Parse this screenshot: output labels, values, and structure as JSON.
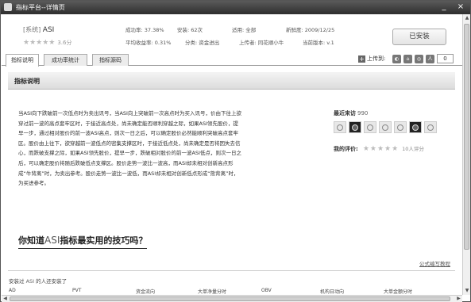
{
  "window": {
    "title": "指标平台--详情页",
    "minimize_label": "_",
    "close_label": "×"
  },
  "header": {
    "system_tag": "[系统]",
    "name": "ASI",
    "stars": "★★★★★",
    "score": "3.6分",
    "win_rate": "成功率: 37.38%",
    "installs": "安装: 62次",
    "applies": "适用: 全部",
    "freshness": "新鲜度: 2009/12/25",
    "avg_return": "平均收益率: 0.31%",
    "category": "分类: 资金进出",
    "uploader": "上传者: 同花顺小牛",
    "version": "当前版本: v.1",
    "install_button": "已安装"
  },
  "tabs": [
    {
      "label": "指标说明",
      "active": true
    },
    {
      "label": "成功率统计",
      "active": false
    },
    {
      "label": "指标源码",
      "active": false
    }
  ],
  "toolbar": {
    "upload_label": "上传到:",
    "count": "0"
  },
  "section": {
    "title": "指标说明"
  },
  "description": "当ASI向下跌破前一次低点时为卖出讯号，当ASI向上突破前一次高点时为买入讯号，价由下往上欲穿过前一波的高点套牢区时，于接近高点处，尚未确定能否顺利穿越之际，如果ASI领先股价，提早一步，通过相对股价的前一波ASI高点，则次一日之后，可以确定股价必然能顺利突破高点套牢区。股价由上往下，欲穿越前一波低点的密集支撑区时，于接近低点处，尚未确定是否将因失去信心，而跌破支撑之际，如果ASI领先股价，提早一步，跌破相对股价的前一波ASI低点，则次一日之后，可以确定股价将随后跌破低点支撑区。股价走势一波比一波高，而ASI却未相对创新高点形成“牛背离”时，为卖出参考。股价走势一波比一波低，而ASI却未相对创新低点形成“熊背离”时，为买进参考。",
  "recent": {
    "label": "最近来访",
    "count": "990"
  },
  "my_rating": {
    "label": "我的评价:",
    "stars": "★★★★★",
    "count": "10人评分"
  },
  "tips": {
    "prefix": "你知道",
    "asi": "ASI",
    "suffix": "指标最实用的技巧吗？"
  },
  "formula_link": "公式编写教程",
  "also_installed": {
    "prefix": "安装过",
    "asi": "ASI",
    "suffix": "的人还安装了"
  },
  "bottom_columns": [
    "AD",
    "PVT",
    "资金流向",
    "大单净量分时",
    "OBV",
    "机构日动向",
    "大单金额分时"
  ]
}
